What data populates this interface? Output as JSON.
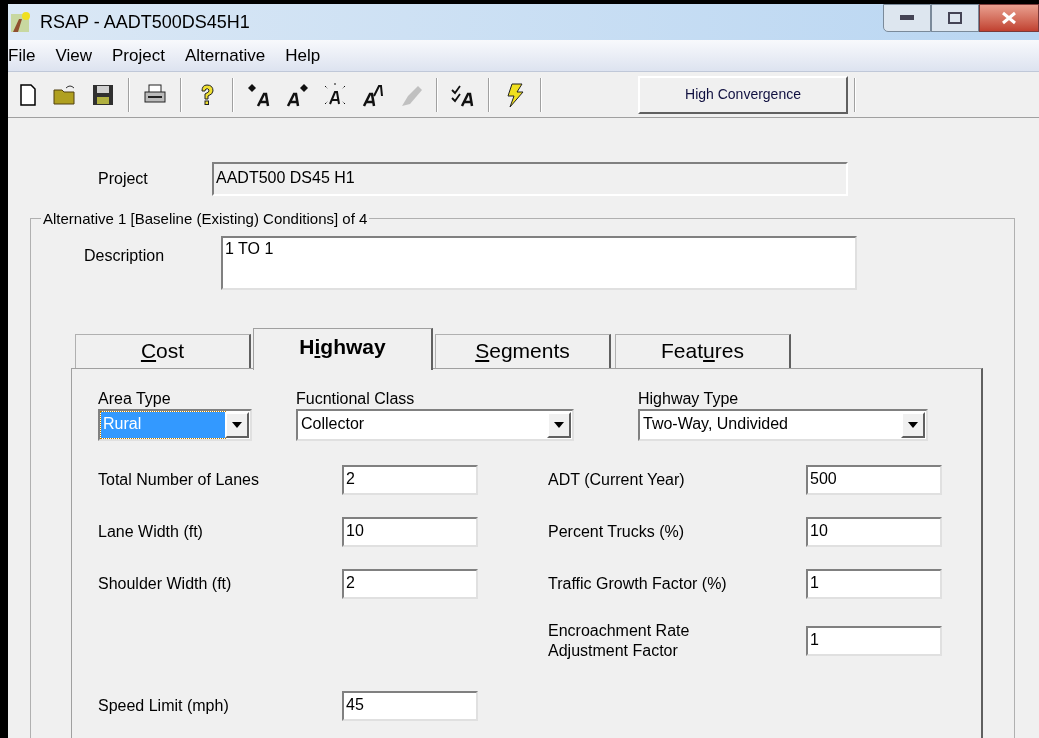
{
  "window": {
    "title": "RSAP - AADT500DS45H1"
  },
  "menu": [
    "File",
    "View",
    "Project",
    "Alternative",
    "Help"
  ],
  "toolbar": {
    "button": "High Convergence"
  },
  "project": {
    "label": "Project",
    "value": "AADT500 DS45 H1"
  },
  "alternative": {
    "title": "Alternative 1 [Baseline (Existing) Conditions] of 4",
    "description_label": "Description",
    "description": "1 TO 1"
  },
  "tabs": [
    {
      "key": "C",
      "after": "ost",
      "selected": false
    },
    {
      "before": "H",
      "key": "i",
      "after": "ghway",
      "selected": true
    },
    {
      "key": "S",
      "after": "egments",
      "selected": false
    },
    {
      "before": "Feat",
      "key": "u",
      "after": "res",
      "selected": false
    }
  ],
  "dropdowns": [
    {
      "label": "Area Type",
      "value": "Rural",
      "focused": true
    },
    {
      "label": "Fucntional Class",
      "value": "Collector",
      "focused": false
    },
    {
      "label": "Highway Type",
      "value": "Two-Way, Undivided",
      "focused": false
    }
  ],
  "left_fields": [
    {
      "label": "Total Number of Lanes",
      "value": "2"
    },
    {
      "label": "Lane Width (ft)",
      "value": "10"
    },
    {
      "label": "Shoulder Width (ft)",
      "value": "2"
    }
  ],
  "right_fields": [
    {
      "label": "ADT (Current Year)",
      "value": "500"
    },
    {
      "label": "Percent Trucks (%)",
      "value": "10"
    },
    {
      "label": "Traffic Growth Factor (%)",
      "value": "1"
    },
    {
      "label": "Encroachment Rate Adjustment Factor",
      "value": "1"
    }
  ],
  "speed_field": {
    "label": "Speed Limit (mph)",
    "value": "45"
  }
}
